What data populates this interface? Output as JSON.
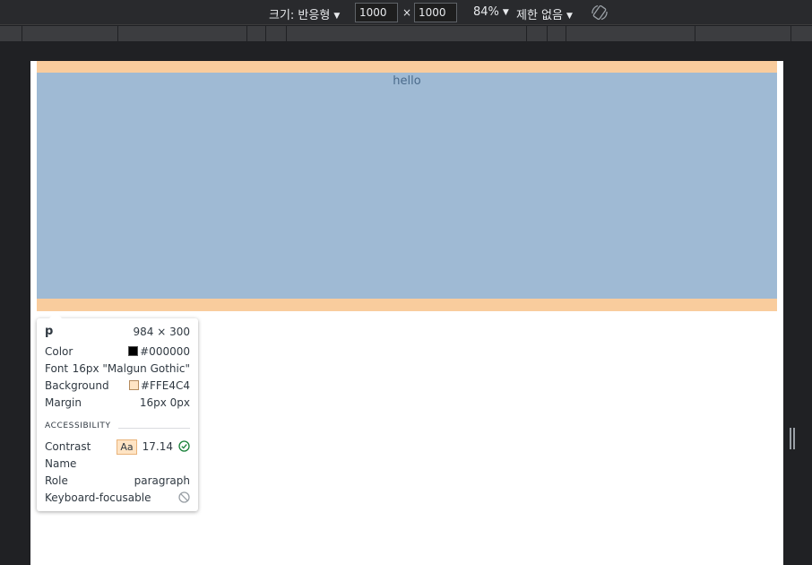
{
  "toolbar": {
    "dimensions_label": "크기: 반응형",
    "width_value": "1000",
    "height_value": "1000",
    "times": "×",
    "zoom": "84%",
    "throttle": "제한 없음",
    "rotate_icon": "rotate-icon"
  },
  "page": {
    "paragraph_text": "hello",
    "colors": {
      "margin": "#f9cc9d",
      "content": "#9fbad4"
    }
  },
  "tooltip": {
    "tag": "p",
    "size": "984 × 300",
    "rows": {
      "color_key": "Color",
      "color_value": "#000000",
      "font_key": "Font",
      "font_value": "16px \"Malgun Gothic\"",
      "background_key": "Background",
      "background_value": "#FFE4C4",
      "margin_key": "Margin",
      "margin_value": "16px 0px"
    },
    "accessibility": {
      "heading": "ACCESSIBILITY",
      "contrast_key": "Contrast",
      "contrast_badge": "Aa",
      "contrast_value": "17.14",
      "name_key": "Name",
      "role_key": "Role",
      "role_value": "paragraph",
      "focusable_key": "Keyboard-focusable"
    }
  }
}
